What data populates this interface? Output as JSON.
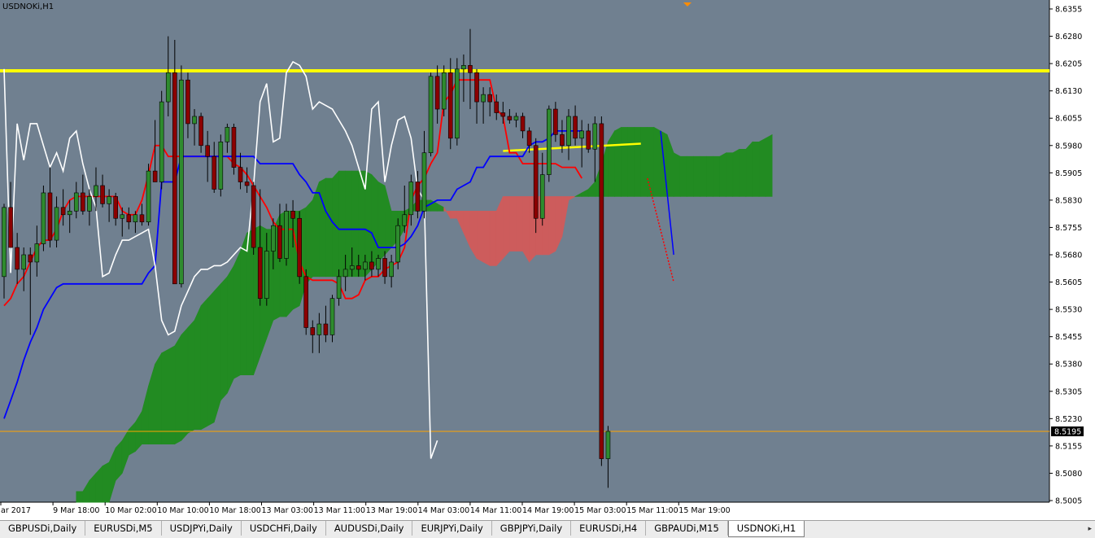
{
  "chart": {
    "symbol_label": "USDNOKi,H1"
  },
  "colors": {
    "background": "#708090",
    "bull_candle": "#2e8b2e",
    "bear_candle": "#8b0000",
    "tenkan": "#ff0000",
    "kijun": "#0000ff",
    "chikou": "#ffffff",
    "kumo_bull": "#228b22",
    "kumo_bear": "#cd5c5c",
    "hline": "#ffff00",
    "bid_line": "#ffa500"
  },
  "tabs": [
    {
      "label": "GBPUSDi,Daily",
      "active": false
    },
    {
      "label": "EURUSDi,M5",
      "active": false
    },
    {
      "label": "USDJPYi,Daily",
      "active": false
    },
    {
      "label": "USDCHFi,Daily",
      "active": false
    },
    {
      "label": "AUDUSDi,Daily",
      "active": false
    },
    {
      "label": "EURJPYi,Daily",
      "active": false
    },
    {
      "label": "GBPJPYi,Daily",
      "active": false
    },
    {
      "label": "EURUSDi,H4",
      "active": false
    },
    {
      "label": "GBPAUDi,M15",
      "active": false
    },
    {
      "label": "USDNOKi,H1",
      "active": true
    }
  ],
  "chart_data": {
    "type": "candlestick",
    "symbol": "USDNOKi",
    "timeframe": "H1",
    "ylim": [
      8.5005,
      8.6355
    ],
    "y_ticks": [
      "8.6355",
      "8.6280",
      "8.6205",
      "8.6130",
      "8.6055",
      "8.5980",
      "8.5905",
      "8.5830",
      "8.5755",
      "8.5680",
      "8.5605",
      "8.5530",
      "8.5455",
      "8.5380",
      "8.5305",
      "8.5230",
      "8.5155",
      "8.5080",
      "8.5005"
    ],
    "x_ticks": [
      "ar 2017",
      "9 Mar 18:00",
      "10 Mar 02:00",
      "10 Mar 10:00",
      "10 Mar 18:00",
      "13 Mar 03:00",
      "13 Mar 11:00",
      "13 Mar 19:00",
      "14 Mar 03:00",
      "14 Mar 11:00",
      "14 Mar 19:00",
      "15 Mar 03:00",
      "15 Mar 11:00",
      "15 Mar 19:00"
    ],
    "current_price": "8.5195",
    "horizontal_line": 8.6185,
    "trend_line": {
      "from": 8.5965,
      "to": 8.5985
    },
    "bars_in_view": 104,
    "candles": [
      [
        8.562,
        8.582,
        8.556,
        8.581
      ],
      [
        8.581,
        8.588,
        8.572,
        8.57
      ],
      [
        8.57,
        8.574,
        8.56,
        8.564
      ],
      [
        8.564,
        8.57,
        8.558,
        8.568
      ],
      [
        8.568,
        8.57,
        8.546,
        8.566
      ],
      [
        8.566,
        8.576,
        8.562,
        8.571
      ],
      [
        8.571,
        8.587,
        8.569,
        8.585
      ],
      [
        8.585,
        8.592,
        8.57,
        8.572
      ],
      [
        8.572,
        8.584,
        8.57,
        8.581
      ],
      [
        8.581,
        8.586,
        8.576,
        8.579
      ],
      [
        8.579,
        8.583,
        8.574,
        8.58
      ],
      [
        8.58,
        8.588,
        8.578,
        8.585
      ],
      [
        8.585,
        8.59,
        8.579,
        8.58
      ],
      [
        8.58,
        8.586,
        8.576,
        8.584
      ],
      [
        8.584,
        8.592,
        8.58,
        8.587
      ],
      [
        8.587,
        8.59,
        8.581,
        8.582
      ],
      [
        8.582,
        8.586,
        8.577,
        8.584
      ],
      [
        8.584,
        8.585,
        8.576,
        8.578
      ],
      [
        8.578,
        8.581,
        8.573,
        8.579
      ],
      [
        8.579,
        8.581,
        8.575,
        8.577
      ],
      [
        8.577,
        8.58,
        8.574,
        8.579
      ],
      [
        8.579,
        8.582,
        8.576,
        8.577
      ],
      [
        8.577,
        8.593,
        8.576,
        8.591
      ],
      [
        8.591,
        8.605,
        8.588,
        8.588
      ],
      [
        8.588,
        8.613,
        8.586,
        8.61
      ],
      [
        8.61,
        8.628,
        8.606,
        8.618
      ],
      [
        8.618,
        8.627,
        8.56,
        8.56
      ],
      [
        8.56,
        8.62,
        8.559,
        8.616
      ],
      [
        8.616,
        8.618,
        8.6,
        8.604
      ],
      [
        8.604,
        8.608,
        8.598,
        8.606
      ],
      [
        8.606,
        8.607,
        8.596,
        8.598
      ],
      [
        8.598,
        8.602,
        8.588,
        8.595
      ],
      [
        8.595,
        8.599,
        8.585,
        8.586
      ],
      [
        8.586,
        8.601,
        8.584,
        8.599
      ],
      [
        8.599,
        8.604,
        8.596,
        8.603
      ],
      [
        8.603,
        8.604,
        8.59,
        8.592
      ],
      [
        8.592,
        8.596,
        8.586,
        8.588
      ],
      [
        8.588,
        8.592,
        8.585,
        8.587
      ],
      [
        8.587,
        8.588,
        8.568,
        8.57
      ],
      [
        8.57,
        8.586,
        8.554,
        8.556
      ],
      [
        8.556,
        8.574,
        8.554,
        8.569
      ],
      [
        8.569,
        8.578,
        8.564,
        8.576
      ],
      [
        8.576,
        8.582,
        8.566,
        8.567
      ],
      [
        8.567,
        8.582,
        8.565,
        8.58
      ],
      [
        8.58,
        8.583,
        8.57,
        8.578
      ],
      [
        8.578,
        8.58,
        8.56,
        8.562
      ],
      [
        8.562,
        8.564,
        8.546,
        8.548
      ],
      [
        8.548,
        8.55,
        8.541,
        8.546
      ],
      [
        8.546,
        8.552,
        8.541,
        8.549
      ],
      [
        8.549,
        8.554,
        8.544,
        8.546
      ],
      [
        8.546,
        8.557,
        8.544,
        8.556
      ],
      [
        8.556,
        8.564,
        8.554,
        8.562
      ],
      [
        8.562,
        8.568,
        8.558,
        8.564
      ],
      [
        8.564,
        8.57,
        8.562,
        8.565
      ],
      [
        8.565,
        8.568,
        8.562,
        8.564
      ],
      [
        8.564,
        8.568,
        8.561,
        8.566
      ],
      [
        8.566,
        8.569,
        8.562,
        8.564
      ],
      [
        8.564,
        8.568,
        8.562,
        8.567
      ],
      [
        8.567,
        8.569,
        8.56,
        8.562
      ],
      [
        8.562,
        8.568,
        8.559,
        8.566
      ],
      [
        8.566,
        8.578,
        8.564,
        8.576
      ],
      [
        8.576,
        8.587,
        8.574,
        8.579
      ],
      [
        8.579,
        8.59,
        8.576,
        8.588
      ],
      [
        8.588,
        8.591,
        8.578,
        8.58
      ],
      [
        8.58,
        8.602,
        8.578,
        8.596
      ],
      [
        8.596,
        8.618,
        8.595,
        8.617
      ],
      [
        8.617,
        8.62,
        8.604,
        8.608
      ],
      [
        8.608,
        8.62,
        8.606,
        8.618
      ],
      [
        8.618,
        8.622,
        8.597,
        8.6
      ],
      [
        8.6,
        8.622,
        8.598,
        8.619
      ],
      [
        8.619,
        8.623,
        8.61,
        8.62
      ],
      [
        8.62,
        8.63,
        8.608,
        8.618
      ],
      [
        8.618,
        8.619,
        8.604,
        8.61
      ],
      [
        8.61,
        8.614,
        8.604,
        8.612
      ],
      [
        8.612,
        8.614,
        8.606,
        8.61
      ],
      [
        8.61,
        8.612,
        8.605,
        8.607
      ],
      [
        8.607,
        8.61,
        8.604,
        8.606
      ],
      [
        8.606,
        8.608,
        8.604,
        8.605
      ],
      [
        8.605,
        8.607,
        8.603,
        8.606
      ],
      [
        8.606,
        8.607,
        8.6,
        8.602
      ],
      [
        8.602,
        8.603,
        8.596,
        8.598
      ],
      [
        8.598,
        8.6,
        8.574,
        8.578
      ],
      [
        8.578,
        8.596,
        8.576,
        8.59
      ],
      [
        8.59,
        8.609,
        8.588,
        8.608
      ],
      [
        8.608,
        8.61,
        8.599,
        8.601
      ],
      [
        8.601,
        8.605,
        8.596,
        8.598
      ],
      [
        8.598,
        8.608,
        8.594,
        8.606
      ],
      [
        8.606,
        8.609,
        8.598,
        8.6
      ],
      [
        8.6,
        8.605,
        8.592,
        8.602
      ],
      [
        8.602,
        8.604,
        8.596,
        8.597
      ],
      [
        8.597,
        8.606,
        8.588,
        8.604
      ],
      [
        8.604,
        8.606,
        8.51,
        8.512
      ],
      [
        8.512,
        8.521,
        8.504,
        8.5195
      ]
    ],
    "series": [
      {
        "name": "Tenkan-sen",
        "values": [
          8.554,
          8.556,
          8.56,
          8.562,
          8.566,
          8.57,
          8.572,
          8.572,
          8.575,
          8.58,
          8.583,
          8.584,
          8.584,
          8.584,
          8.584,
          8.584,
          8.584,
          8.584,
          8.58,
          8.579,
          8.579,
          8.583,
          8.59,
          8.598,
          8.598,
          8.595,
          8.595,
          8.595,
          8.595,
          8.595,
          8.595,
          8.595,
          8.595,
          8.595,
          8.595,
          8.593,
          8.592,
          8.59,
          8.587,
          8.584,
          8.581,
          8.577,
          8.575,
          8.575,
          8.575,
          8.566,
          8.562,
          8.561,
          8.561,
          8.561,
          8.561,
          8.56,
          8.556,
          8.556,
          8.557,
          8.561,
          8.562,
          8.562,
          8.564,
          8.565,
          8.566,
          8.57,
          8.583,
          8.587,
          8.589,
          8.593,
          8.596,
          8.61,
          8.612,
          8.616,
          8.616,
          8.616,
          8.616,
          8.616,
          8.616,
          8.608,
          8.606,
          8.596,
          8.596,
          8.593,
          8.593,
          8.593,
          8.593,
          8.593,
          8.593,
          8.592,
          8.592,
          8.592,
          8.589
        ]
      },
      {
        "name": "Kijun-sen",
        "values": [
          8.523,
          8.528,
          8.533,
          8.539,
          8.544,
          8.548,
          8.553,
          8.556,
          8.559,
          8.56,
          8.56,
          8.56,
          8.56,
          8.56,
          8.56,
          8.56,
          8.56,
          8.56,
          8.56,
          8.56,
          8.56,
          8.56,
          8.563,
          8.565,
          8.588,
          8.588,
          8.588,
          8.595,
          8.595,
          8.595,
          8.595,
          8.595,
          8.595,
          8.595,
          8.595,
          8.595,
          8.595,
          8.595,
          8.595,
          8.593,
          8.593,
          8.593,
          8.593,
          8.593,
          8.593,
          8.59,
          8.588,
          8.585,
          8.585,
          8.58,
          8.577,
          8.575,
          8.575,
          8.575,
          8.575,
          8.575,
          8.574,
          8.57,
          8.57,
          8.57,
          8.57,
          8.571,
          8.573,
          8.576,
          8.581,
          8.582,
          8.583,
          8.583,
          8.583,
          8.586,
          8.587,
          8.588,
          8.592,
          8.592,
          8.595,
          8.595,
          8.595,
          8.595,
          8.595,
          8.595,
          8.598,
          8.599,
          8.599,
          8.6,
          8.602,
          8.602,
          8.602,
          8.602,
          8.602
        ]
      },
      {
        "name": "Chikou Span",
        "values": [
          8.619,
          8.563,
          8.604,
          8.594,
          8.604,
          8.604,
          8.598,
          8.592,
          8.596,
          8.591,
          8.6,
          8.602,
          8.593,
          8.586,
          8.581,
          8.562,
          8.563,
          8.568,
          8.572,
          8.572,
          8.573,
          8.574,
          8.575,
          8.565,
          8.55,
          8.546,
          8.547,
          8.554,
          8.558,
          8.562,
          8.564,
          8.564,
          8.565,
          8.565,
          8.566,
          8.568,
          8.57,
          8.569,
          8.587,
          8.61,
          8.615,
          8.599,
          8.6,
          8.618,
          8.621,
          8.62,
          8.617,
          8.608,
          8.61,
          8.609,
          8.608,
          8.605,
          8.602,
          8.598,
          8.592,
          8.586,
          8.608,
          8.61,
          8.588,
          8.598,
          8.605,
          8.606,
          8.6,
          8.586,
          8.583,
          8.512,
          8.517
        ]
      },
      {
        "name": "Senkou Span A",
        "values": [
          8.503,
          8.503,
          8.506,
          8.508,
          8.51,
          8.511,
          8.515,
          8.517,
          8.52,
          8.522,
          8.525,
          8.532,
          8.538,
          8.541,
          8.542,
          8.543,
          8.546,
          8.548,
          8.55,
          8.554,
          8.556,
          8.558,
          8.56,
          8.562,
          8.565,
          8.569,
          8.574,
          8.575,
          8.576,
          8.575,
          8.575,
          8.579,
          8.58,
          8.58,
          8.58,
          8.581,
          8.583,
          8.588,
          8.589,
          8.589,
          8.591,
          8.591,
          8.591,
          8.591,
          8.591,
          8.59,
          8.588,
          8.587,
          8.58,
          8.58,
          8.58,
          8.581,
          8.583,
          8.583,
          8.583,
          8.582,
          8.581,
          8.578,
          8.578,
          8.574,
          8.57,
          8.567,
          8.566,
          8.565,
          8.565,
          8.567,
          8.569,
          8.569,
          8.569,
          8.566,
          8.568,
          8.568,
          8.568,
          8.569,
          8.573,
          8.583,
          8.584,
          8.585,
          8.586,
          8.588,
          8.593,
          8.599,
          8.602,
          8.603,
          8.603,
          8.603,
          8.603,
          8.603,
          8.603,
          8.602,
          8.601,
          8.596,
          8.595,
          8.595,
          8.595,
          8.595,
          8.595,
          8.595,
          8.595,
          8.596,
          8.596,
          8.597,
          8.597,
          8.599,
          8.599,
          8.6,
          8.601
        ]
      },
      {
        "name": "Senkou Span B",
        "values": [
          8.5,
          8.5,
          8.5,
          8.5,
          8.5,
          8.5,
          8.506,
          8.508,
          8.513,
          8.514,
          8.516,
          8.516,
          8.516,
          8.516,
          8.516,
          8.516,
          8.517,
          8.519,
          8.52,
          8.52,
          8.521,
          8.522,
          8.528,
          8.53,
          8.534,
          8.535,
          8.535,
          8.535,
          8.54,
          8.545,
          8.55,
          8.551,
          8.551,
          8.553,
          8.554,
          8.56,
          8.562,
          8.562,
          8.562,
          8.562,
          8.562,
          8.562,
          8.562,
          8.562,
          8.562,
          8.564,
          8.566,
          8.568,
          8.57,
          8.572,
          8.575,
          8.58,
          8.58,
          8.58,
          8.58,
          8.58,
          8.58,
          8.58,
          8.58,
          8.58,
          8.58,
          8.58,
          8.58,
          8.58,
          8.58,
          8.584,
          8.584,
          8.584,
          8.584,
          8.584,
          8.584,
          8.584,
          8.584,
          8.584,
          8.584,
          8.584,
          8.584,
          8.584,
          8.584,
          8.584,
          8.584,
          8.584,
          8.584,
          8.584,
          8.584,
          8.584,
          8.584,
          8.584,
          8.584,
          8.584,
          8.584,
          8.584,
          8.584,
          8.584,
          8.584,
          8.584,
          8.584,
          8.584,
          8.584,
          8.584,
          8.584,
          8.584,
          8.584,
          8.584,
          8.584,
          8.584,
          8.584
        ]
      }
    ]
  }
}
